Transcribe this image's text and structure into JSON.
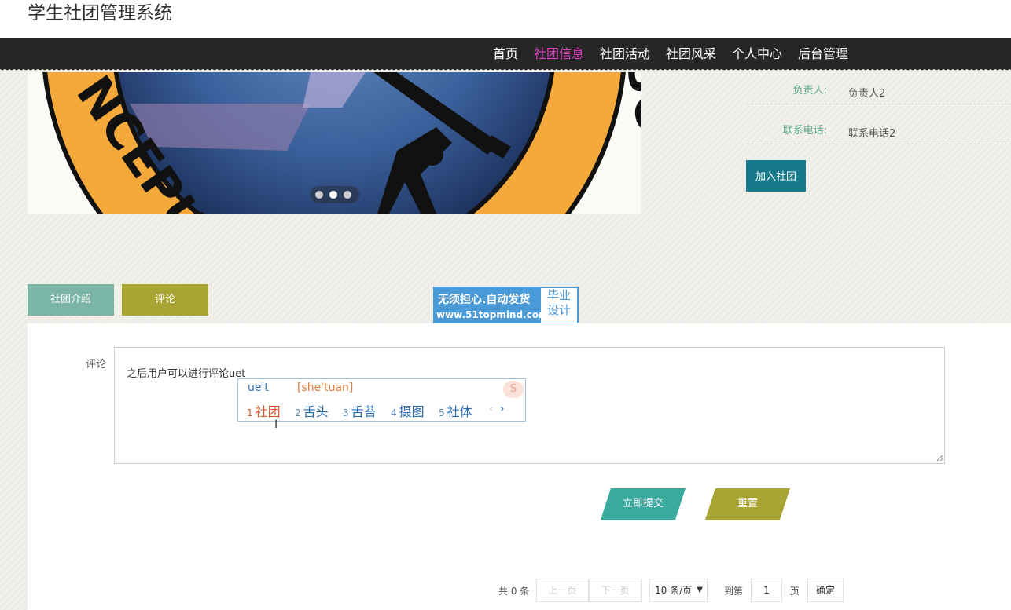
{
  "header": {
    "site_title": "学生社团管理系统",
    "nav": [
      {
        "label": "首页",
        "active": false
      },
      {
        "label": "社团信息",
        "active": true
      },
      {
        "label": "社团活动",
        "active": false
      },
      {
        "label": "社团风采",
        "active": false
      },
      {
        "label": "个人中心",
        "active": false
      },
      {
        "label": "后台管理",
        "active": false
      }
    ],
    "active_color": "#e040c8"
  },
  "banner": {
    "logo_text_left": "NCEPU",
    "logo_text_right": "SOCIETY",
    "slide_count": 3,
    "active_slide": 2
  },
  "info": {
    "leader_label": "负责人:",
    "leader_value": "负责人2",
    "phone_label": "联系电话:",
    "phone_value": "联系电话2",
    "join_button": "加入社团"
  },
  "tabs": [
    {
      "label": "社团介绍"
    },
    {
      "label": "评论"
    }
  ],
  "ad": {
    "line1": "无须担心.自动发货",
    "line2": "www.51topmind.com",
    "right_top": "毕业",
    "right_bottom": "设计"
  },
  "comment": {
    "label": "评论",
    "value": "之后用户可以进行评论uet"
  },
  "ime": {
    "input": "ue't",
    "pinyin": "[she'tuan]",
    "logo": "S",
    "candidates": [
      {
        "num": "1",
        "text": "社团"
      },
      {
        "num": "2",
        "text": "舌头"
      },
      {
        "num": "3",
        "text": "舌苔"
      },
      {
        "num": "4",
        "text": "摄图"
      },
      {
        "num": "5",
        "text": "社体"
      }
    ],
    "prev": "‹",
    "next": "›"
  },
  "actions": {
    "submit": "立即提交",
    "reset": "重置"
  },
  "pagination": {
    "total": "共 0 条",
    "prev": "上一页",
    "next": "下一页",
    "page_size": "10 条/页",
    "goto_label": "到第",
    "page_value": "1",
    "page_unit": "页",
    "confirm": "确定"
  }
}
